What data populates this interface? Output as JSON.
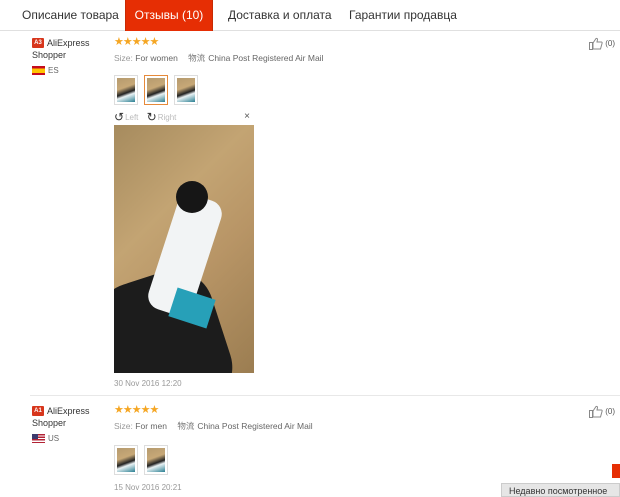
{
  "tabs": [
    {
      "label": "Описание товара",
      "active": false
    },
    {
      "label": "Отзывы (10)",
      "active": true
    },
    {
      "label": "Доставка и оплата",
      "active": false
    },
    {
      "label": "Гарантии продавца",
      "active": false
    }
  ],
  "reviews": [
    {
      "badge": "A3",
      "user_line1": "AliExpress",
      "user_line2": "Shopper",
      "country": "ES",
      "stars": "★★★★★",
      "size_label": "Size:",
      "size_value": "For women",
      "ship_cn": "物流",
      "shipping": "China Post Registered Air Mail",
      "helpful_count": "(0)",
      "date": "30 Nov 2016 12:20",
      "viewer": {
        "left_label": "Left",
        "right_label": "Right",
        "close": "×"
      }
    },
    {
      "badge": "A1",
      "user_line1": "AliExpress",
      "user_line2": "Shopper",
      "country": "US",
      "stars": "★★★★★",
      "size_label": "Size:",
      "size_value": "For men",
      "ship_cn": "物流",
      "shipping": "China Post Registered Air Mail",
      "helpful_count": "(0)",
      "date": "15 Nov 2016 20:21"
    }
  ],
  "recently_viewed": "Недавно посмотренное",
  "colors": {
    "accent": "#e62e04",
    "stars": "#f5a623",
    "thumb_selected": "#e68a3a"
  }
}
